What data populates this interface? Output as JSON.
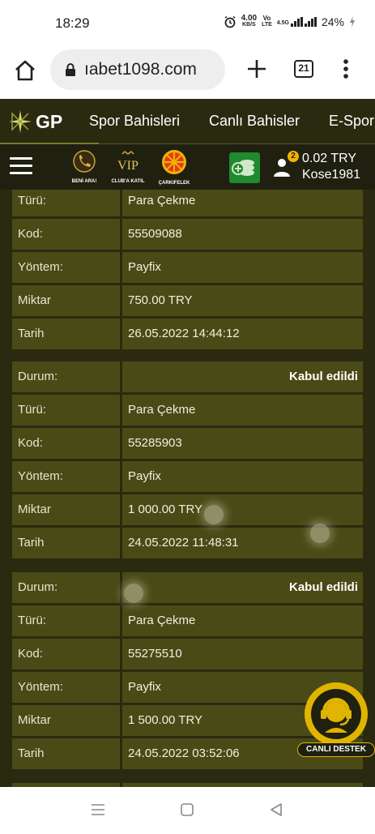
{
  "status_bar": {
    "time": "18:29",
    "network_speed": "4.00",
    "network_speed_unit": "KB/S",
    "volte_top": "Vo",
    "volte_bottom": "LTE",
    "signal_label": "4.5G",
    "battery": "24%"
  },
  "browser": {
    "url": "ıabet1098.com",
    "tab_count": "21"
  },
  "site_nav": {
    "logo": "GP",
    "items": [
      "Spor Bahisleri",
      "Canlı Bahisler",
      "E-Spor"
    ]
  },
  "sub_bar": {
    "promos": [
      {
        "label": "BENİ ARA!",
        "icon": "phone-icon"
      },
      {
        "label": "CLUB'A KATIL",
        "icon": "vip-icon"
      },
      {
        "label": "ÇARKIFELEK",
        "icon": "wheel-icon"
      }
    ],
    "badge_count": "2",
    "balance": "0.02 TRY",
    "username": "Kose1981"
  },
  "transactions": [
    {
      "rows": [
        {
          "label": "Türü:",
          "value": "Para Çekme"
        },
        {
          "label": "Kod:",
          "value": "55509088"
        },
        {
          "label": "Yöntem:",
          "value": "Payfix"
        },
        {
          "label": "Miktar",
          "value": "750.00 TRY"
        },
        {
          "label": "Tarih",
          "value": "26.05.2022 14:44:12"
        }
      ]
    },
    {
      "status_label": "Durum:",
      "status_value": "Kabul edildi",
      "rows": [
        {
          "label": "Türü:",
          "value": "Para Çekme"
        },
        {
          "label": "Kod:",
          "value": "55285903"
        },
        {
          "label": "Yöntem:",
          "value": "Payfix"
        },
        {
          "label": "Miktar",
          "value": "1 000.00 TRY"
        },
        {
          "label": "Tarih",
          "value": "24.05.2022 11:48:31"
        }
      ]
    },
    {
      "status_label": "Durum:",
      "status_value": "Kabul edildi",
      "rows": [
        {
          "label": "Türü:",
          "value": "Para Çekme"
        },
        {
          "label": "Kod:",
          "value": "55275510"
        },
        {
          "label": "Yöntem:",
          "value": "Payfix"
        },
        {
          "label": "Miktar",
          "value": "1 500.00 TRY"
        },
        {
          "label": "Tarih",
          "value": "24.05.2022 03:52:06"
        }
      ]
    }
  ],
  "live_support": {
    "label": "CANLI DESTEK"
  },
  "colors": {
    "page_bg": "#2a2a10",
    "cell_bg": "#4a4a17",
    "accent_yellow": "#e0b400",
    "wallet_green": "#1f8a2e"
  }
}
